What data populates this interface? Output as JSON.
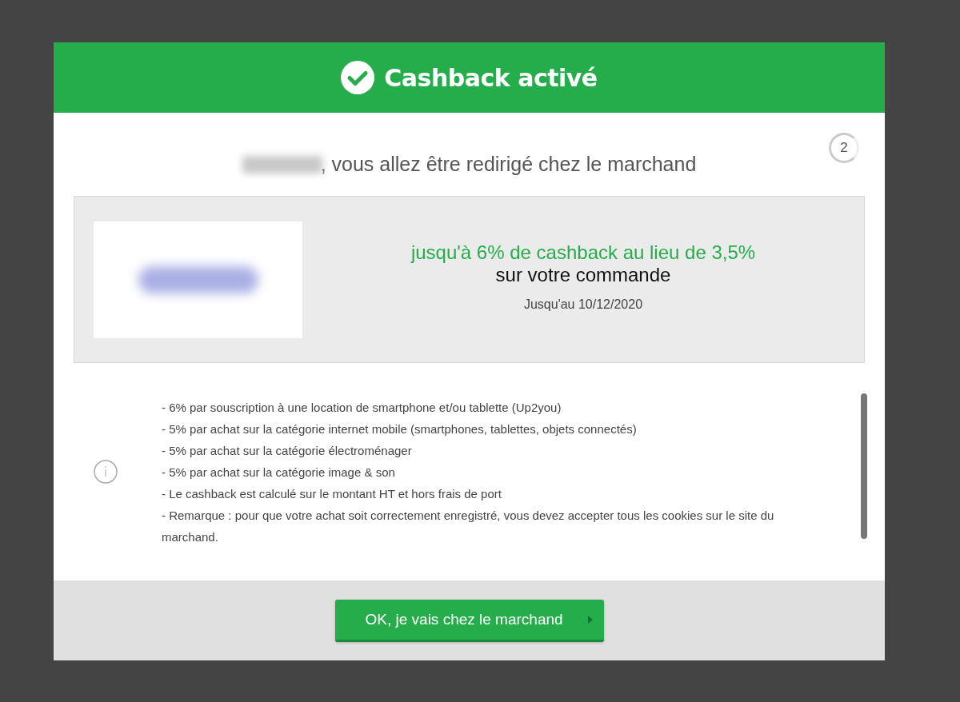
{
  "header": {
    "title": "Cashback activé"
  },
  "redirect": {
    "message": ", vous allez être redirigé chez le marchand",
    "countdown": "2"
  },
  "offer": {
    "headline": "jusqu'à 6% de cashback au lieu de 3,5%",
    "subline": "sur votre commande",
    "validity": "Jusqu'au 10/12/2020"
  },
  "conditions": [
    "-  6% par souscription à une location de smartphone et/ou tablette (Up2you)",
    "-  5% par achat sur la catégorie internet mobile (smartphones, tablettes, objets connectés)",
    "-  5% par achat sur la catégorie électroménager",
    "-  5% par achat sur la catégorie image & son",
    "-  Le cashback est calculé sur le montant HT et hors frais de port",
    "-  Remarque : pour que votre achat soit correctement enregistré, vous devez accepter tous les cookies sur le site du marchand."
  ],
  "footer": {
    "button": "OK, je vais chez le marchand"
  }
}
